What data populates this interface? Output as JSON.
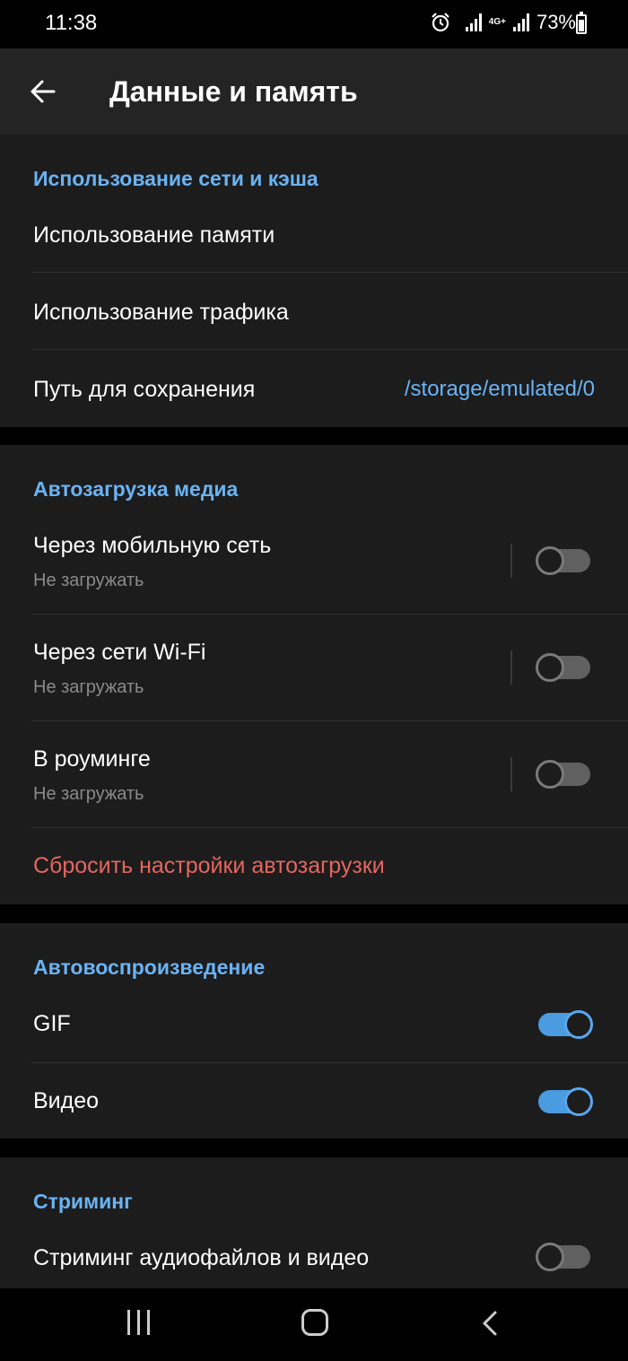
{
  "status": {
    "time": "11:38",
    "network": "4G+",
    "battery": "73%"
  },
  "appbar": {
    "title": "Данные и память"
  },
  "sections": {
    "cache": {
      "title": "Использование сети и кэша",
      "memory_usage": "Использование памяти",
      "traffic_usage": "Использование трафика",
      "save_path_label": "Путь для сохранения",
      "save_path_value": "/storage/emulated/0"
    },
    "autodownload": {
      "title": "Автозагрузка медиа",
      "mobile": {
        "label": "Через мобильную сеть",
        "sub": "Не загружать",
        "enabled": false
      },
      "wifi": {
        "label": "Через сети Wi-Fi",
        "sub": "Не загружать",
        "enabled": false
      },
      "roaming": {
        "label": "В роуминге",
        "sub": "Не загружать",
        "enabled": false
      },
      "reset": "Сбросить настройки автозагрузки"
    },
    "autoplay": {
      "title": "Автовоспроизведение",
      "gif": {
        "label": "GIF",
        "enabled": true
      },
      "video": {
        "label": "Видео",
        "enabled": true
      }
    },
    "streaming": {
      "title": "Стриминг",
      "stream": {
        "label": "Стриминг аудиофайлов и видео",
        "enabled": false
      }
    }
  },
  "colors": {
    "accent": "#6ab3f3",
    "danger": "#e5665f",
    "background": "#1c1c1d",
    "appbar": "#242424"
  },
  "icons": {
    "back": "arrow-left-icon",
    "alarm": "alarm-icon",
    "battery": "battery-icon",
    "signal": "signal-icon"
  }
}
